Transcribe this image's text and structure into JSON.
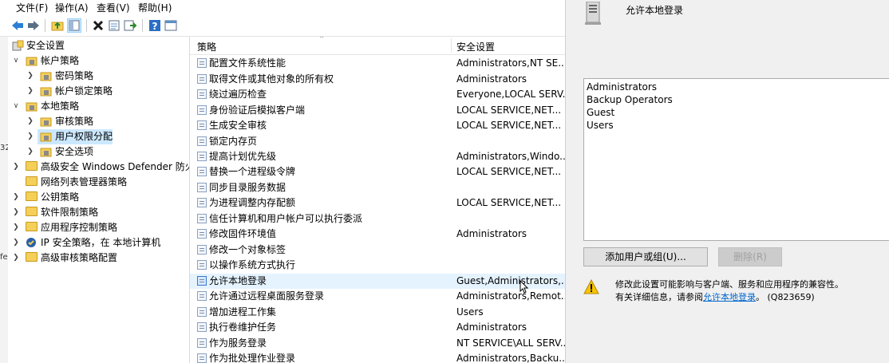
{
  "menu": {
    "file": "文件(F)",
    "action": "操作(A)",
    "view": "查看(V)",
    "help": "帮助(H)"
  },
  "toolbar": {
    "icons": [
      "back-icon",
      "forward-icon",
      "up-folder-icon",
      "show-hide-tree-icon",
      "delete-icon",
      "properties-icon",
      "export-list-icon",
      "help-icon",
      "show-console-icon"
    ]
  },
  "gutter": {
    "fragment_a": "32",
    "fragment_b": "fe"
  },
  "tree": {
    "root": "安全设置",
    "account_policies": "帐户策略",
    "password_policy": "密码策略",
    "lockout_policy": "帐户锁定策略",
    "local_policies": "本地策略",
    "audit_policy": "审核策略",
    "user_rights": "用户权限分配",
    "security_options": "安全选项",
    "firewall": "高级安全 Windows Defender 防火墙",
    "network_list": "网络列表管理器策略",
    "public_key": "公钥策略",
    "software_restriction": "软件限制策略",
    "app_control": "应用程序控制策略",
    "ipsec": "IP 安全策略，在 本地计算机",
    "advanced_audit": "高级审核策略配置"
  },
  "list": {
    "col_policy": "策略",
    "col_setting": "安全设置",
    "rows": [
      {
        "policy": "配置文件系统性能",
        "setting": "Administrators,NT SE..."
      },
      {
        "policy": "取得文件或其他对象的所有权",
        "setting": "Administrators"
      },
      {
        "policy": "绕过遍历检查",
        "setting": "Everyone,LOCAL SERV..."
      },
      {
        "policy": "身份验证后模拟客户端",
        "setting": "LOCAL SERVICE,NET..."
      },
      {
        "policy": "生成安全审核",
        "setting": "LOCAL SERVICE,NET..."
      },
      {
        "policy": "锁定内存页",
        "setting": ""
      },
      {
        "policy": "提高计划优先级",
        "setting": "Administrators,Windo..."
      },
      {
        "policy": "替换一个进程级令牌",
        "setting": "LOCAL SERVICE,NET..."
      },
      {
        "policy": "同步目录服务数据",
        "setting": ""
      },
      {
        "policy": "为进程调整内存配额",
        "setting": "LOCAL SERVICE,NET..."
      },
      {
        "policy": "信任计算机和用户帐户可以执行委派",
        "setting": ""
      },
      {
        "policy": "修改固件环境值",
        "setting": "Administrators"
      },
      {
        "policy": "修改一个对象标签",
        "setting": ""
      },
      {
        "policy": "以操作系统方式执行",
        "setting": ""
      },
      {
        "policy": "允许本地登录",
        "setting": "Guest,Administrators,..."
      },
      {
        "policy": "允许通过远程桌面服务登录",
        "setting": "Administrators,Remot..."
      },
      {
        "policy": "增加进程工作集",
        "setting": "Users"
      },
      {
        "policy": "执行卷维护任务",
        "setting": "Administrators"
      },
      {
        "policy": "作为服务登录",
        "setting": "NT SERVICE\\ALL SERV..."
      },
      {
        "policy": "作为批处理作业登录",
        "setting": "Administrators,Backu..."
      }
    ]
  },
  "dialog": {
    "title": "允许本地登录",
    "users": [
      "Administrators",
      "Backup Operators",
      "Guest",
      "Users"
    ],
    "add_button": "添加用户或组(U)...",
    "remove_button": "删除(R)",
    "warning_line1": "修改此设置可能影响与客户端、服务和应用程序的兼容性。",
    "warning_prefix": "有关详细信息，请参阅",
    "warning_link": "允许本地登录",
    "warning_suffix": "。 (Q823659)"
  },
  "colors": {
    "selection": "#cce8ff",
    "hover": "#e5f3ff",
    "link": "#0066cc",
    "dialog_bg": "#f0f0f0"
  }
}
